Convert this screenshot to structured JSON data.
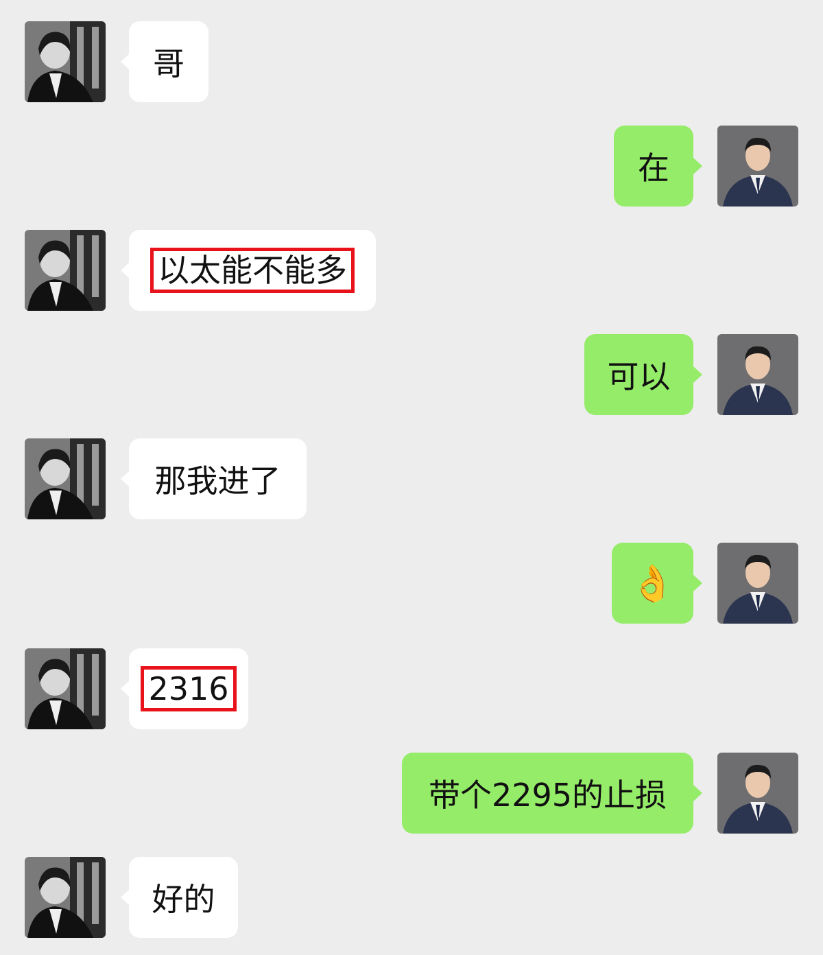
{
  "conversation": {
    "messages": [
      {
        "sender": "contact",
        "text": "哥"
      },
      {
        "sender": "me",
        "text": "在"
      },
      {
        "sender": "contact",
        "text": "以太能不能多",
        "highlighted": true
      },
      {
        "sender": "me",
        "text": "可以"
      },
      {
        "sender": "contact",
        "text": "那我进了"
      },
      {
        "sender": "me",
        "text": "👌"
      },
      {
        "sender": "contact",
        "text": "2316",
        "highlighted": true
      },
      {
        "sender": "me",
        "text": "带个2295的止损"
      },
      {
        "sender": "contact",
        "text": "好的"
      }
    ]
  },
  "colors": {
    "background": "#ededed",
    "incoming_bubble": "#ffffff",
    "outgoing_bubble": "#95ec69",
    "highlight_box": "#e8121b"
  }
}
